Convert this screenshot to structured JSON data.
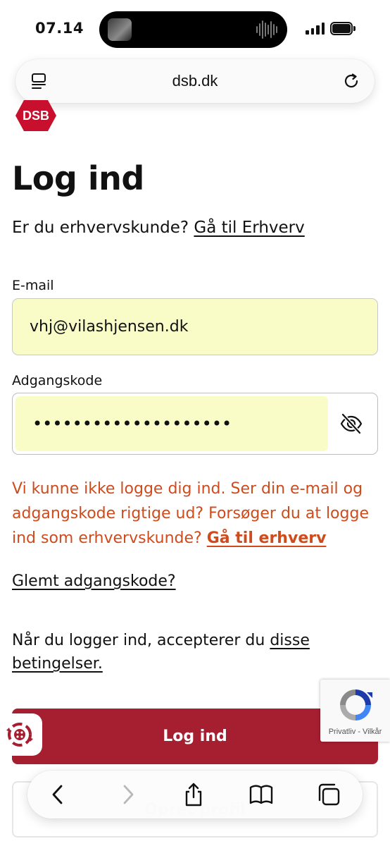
{
  "status_bar": {
    "time": "07.14"
  },
  "browser": {
    "url": "dsb.dk"
  },
  "logo": {
    "text": "DSB",
    "color": "#c8102e"
  },
  "page": {
    "title": "Log ind",
    "business_prompt": "Er du erhvervskunde?",
    "business_link": "Gå til Erhverv"
  },
  "form": {
    "email_label": "E-mail",
    "email_value": "vhj@vilashjensen.dk",
    "password_label": "Adgangskode",
    "password_value": "••••••••••••••••••••",
    "error_text": "Vi kunne ikke logge dig ind. Ser din e-mail og adgangskode rigtige ud? Forsøger du at logge ind som erhvervskunde?",
    "error_link": "Gå til erhverv",
    "forgot_link": "Glemt adgangskode?",
    "terms_text": "Når du logger ind, accepterer du",
    "terms_link": "disse betingelser.",
    "login_button": "Log ind",
    "create_profile_button": "Opret profil"
  },
  "recaptcha": {
    "privacy": "Privatliv",
    "separator": " - ",
    "terms": "Vilkår"
  },
  "colors": {
    "brand_red": "#a51f30",
    "error": "#cf4b1c",
    "autofill": "#fafcc8"
  },
  "icons": {
    "reader": "reader-mode-icon",
    "reload": "reload-icon",
    "eye": "eye-slash-icon",
    "back": "chevron-left-icon",
    "forward": "chevron-right-icon",
    "share": "share-icon",
    "bookmarks": "book-icon",
    "tabs": "tabs-icon"
  }
}
